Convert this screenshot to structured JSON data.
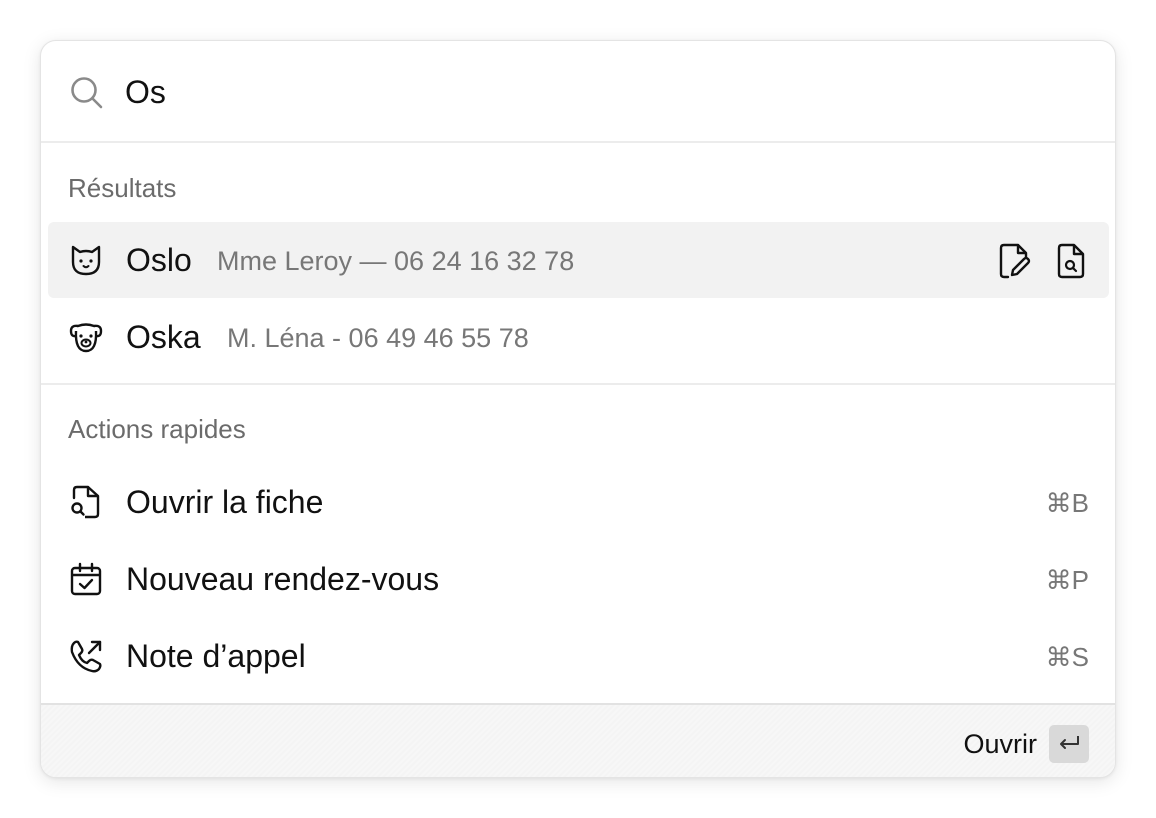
{
  "search": {
    "value": "Os",
    "icon": "search-icon"
  },
  "sections": {
    "results_label": "Résultats",
    "actions_label": "Actions rapides"
  },
  "results": [
    {
      "name": "Oslo",
      "meta": "Mme Leroy — 06 24 16 32 78",
      "icon": "cat-icon",
      "selected": true,
      "actions": [
        "edit-document-icon",
        "search-document-icon"
      ]
    },
    {
      "name": "Oska",
      "meta": "M. Léna - 06 49 46 55 78",
      "icon": "dog-icon",
      "selected": false
    }
  ],
  "actions": [
    {
      "label": "Ouvrir la fiche",
      "shortcut": "⌘B",
      "icon": "file-search-icon"
    },
    {
      "label": "Nouveau rendez-vous",
      "shortcut": "⌘P",
      "icon": "calendar-check-icon"
    },
    {
      "label": "Note d’appel",
      "shortcut": "⌘S",
      "icon": "phone-outgoing-icon"
    }
  ],
  "footer": {
    "open_label": "Ouvrir",
    "enter_icon": "enter-key-icon"
  },
  "colors": {
    "selected_row": "#f2f2f2",
    "muted_text": "#777777",
    "section_label": "#6b6b6b",
    "key_background": "#d9d9d9"
  }
}
